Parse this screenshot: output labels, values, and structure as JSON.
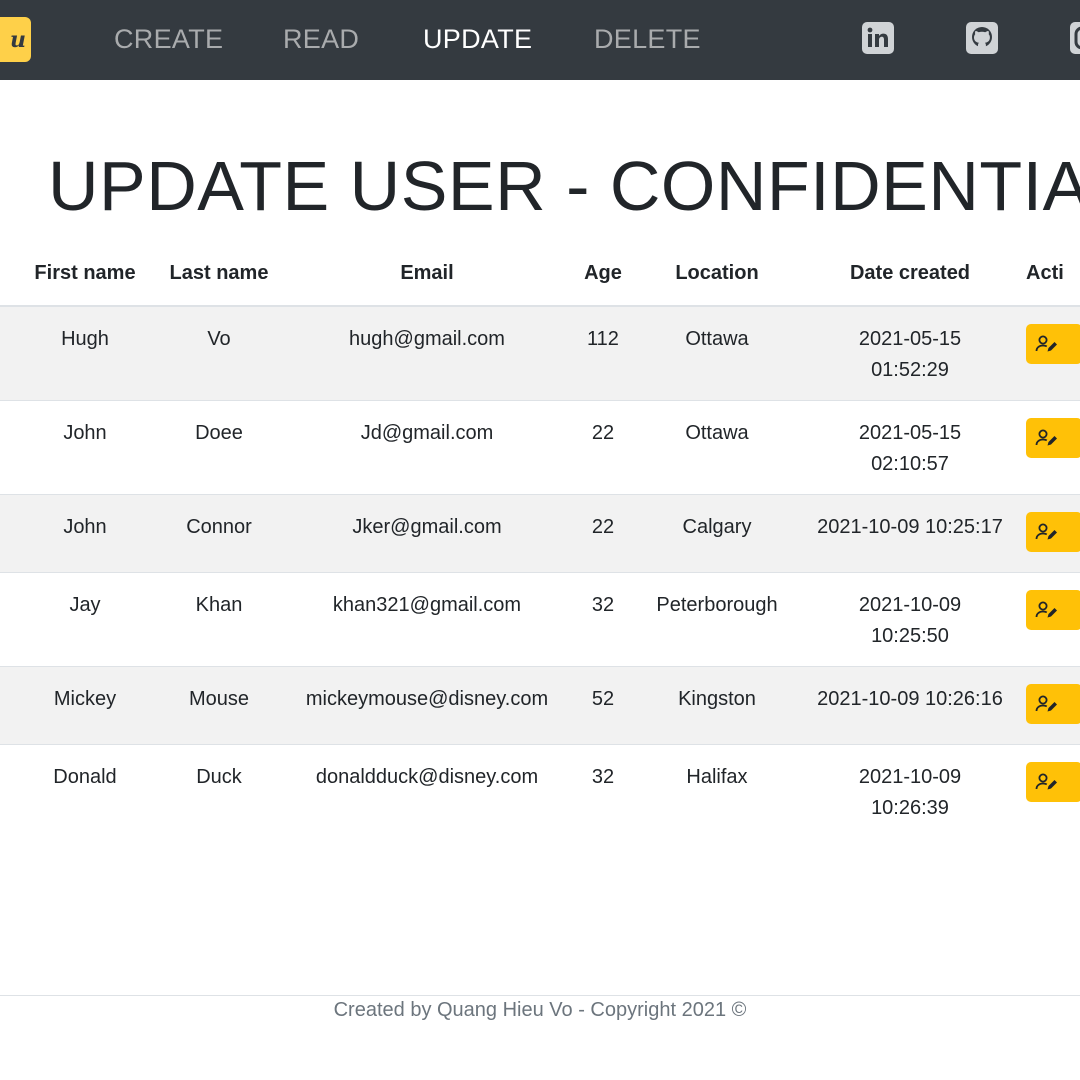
{
  "nav": {
    "logo_text": "u",
    "links": [
      "CREATE",
      "READ",
      "UPDATE",
      "DELETE"
    ],
    "active": "UPDATE",
    "social_icons": [
      "linkedin-icon",
      "github-icon",
      "instagram-icon"
    ]
  },
  "page": {
    "title": "UPDATE USER - CONFIDENTIAL"
  },
  "table": {
    "headers": {
      "first_name": "First name",
      "last_name": "Last name",
      "email": "Email",
      "age": "Age",
      "location": "Location",
      "date_created": "Date created",
      "action": "Acti"
    },
    "rows": [
      {
        "first": "Hugh",
        "last": "Vo",
        "email": "hugh@gmail.com",
        "age": "112",
        "location": "Ottawa",
        "date": "2021-05-15 01:52:29"
      },
      {
        "first": "John",
        "last": "Doee",
        "email": "Jd@gmail.com",
        "age": "22",
        "location": "Ottawa",
        "date": "2021-05-15 02:10:57"
      },
      {
        "first": "John",
        "last": "Connor",
        "email": "Jker@gmail.com",
        "age": "22",
        "location": "Calgary",
        "date": "2021-10-09 10:25:17"
      },
      {
        "first": "Jay",
        "last": "Khan",
        "email": "khan321@gmail.com",
        "age": "32",
        "location": "Peterborough",
        "date": "2021-10-09 10:25:50"
      },
      {
        "first": "Mickey",
        "last": "Mouse",
        "email": "mickeymouse@disney.com",
        "age": "52",
        "location": "Kingston",
        "date": "2021-10-09 10:26:16"
      },
      {
        "first": "Donald",
        "last": "Duck",
        "email": "donaldduck@disney.com",
        "age": "32",
        "location": "Halifax",
        "date": "2021-10-09 10:26:39"
      }
    ]
  },
  "footer": {
    "text": "Created by Quang Hieu Vo - Copyright 2021 ©"
  },
  "colors": {
    "navbar": "#343a40",
    "logo": "#fed049",
    "action_button": "#ffc107",
    "stripe": "#f2f2f2"
  }
}
